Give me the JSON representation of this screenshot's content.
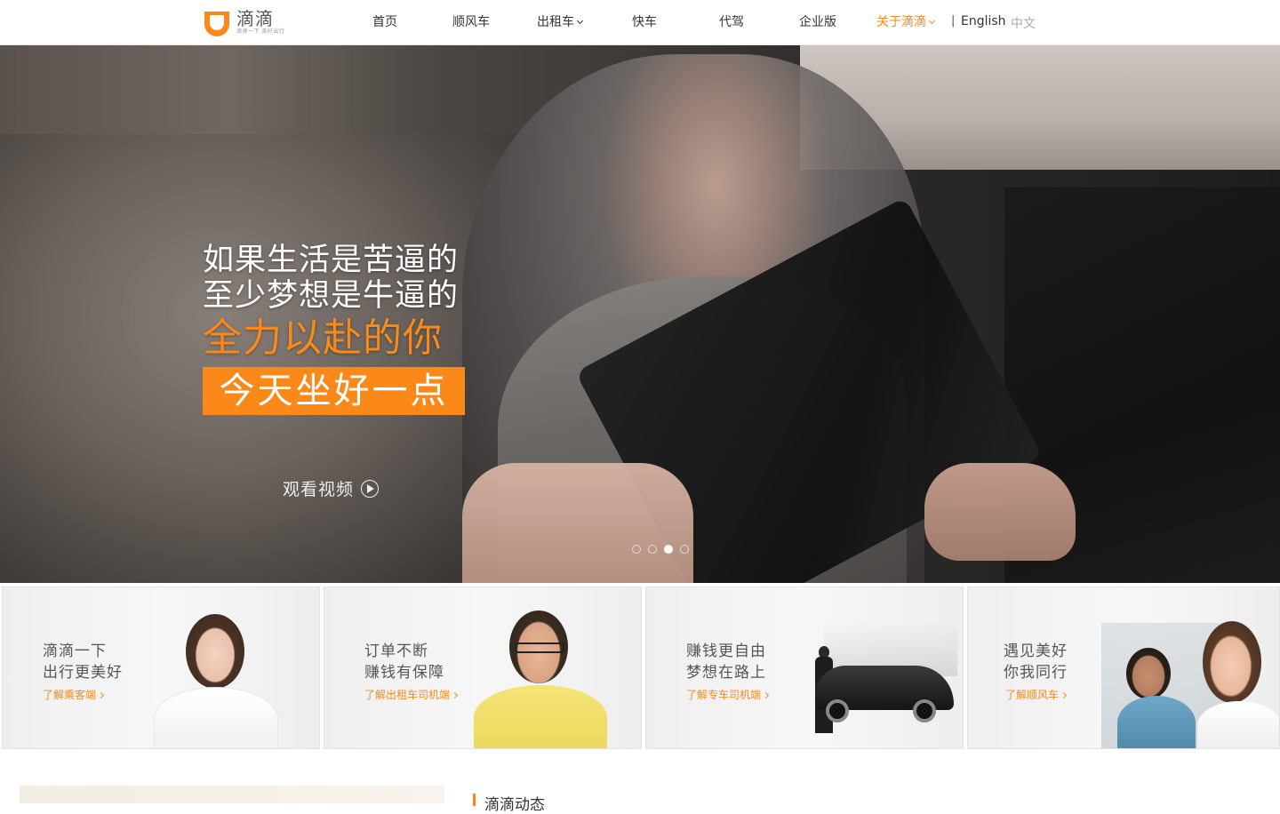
{
  "header": {
    "logo": {
      "name": "滴滴",
      "slogan": "滴滴一下 美好出行",
      "icon": "didi-logo-icon",
      "color": "#fa8919"
    },
    "nav": [
      {
        "label": "首页"
      },
      {
        "label": "顺风车"
      },
      {
        "label": "出租车",
        "dropdown": true
      },
      {
        "label": "快车"
      },
      {
        "label": "代驾"
      },
      {
        "label": "企业版"
      },
      {
        "label": "关于滴滴",
        "dropdown": true,
        "active": true
      }
    ],
    "lang_separator": "|",
    "lang_en": "English",
    "lang_zh": "中文"
  },
  "hero": {
    "line1": "如果生活是苦逼的",
    "line2": "至少梦想是牛逼的",
    "line3": "全力以赴的你",
    "highlight": "今天坐好一点",
    "video_label": "观看视频",
    "video_icon": "play-circle-icon",
    "slides": 4,
    "active_slide": 3
  },
  "cards": [
    {
      "title_line1": "滴滴一下",
      "title_line2": "出行更美好",
      "link": "了解乘客端"
    },
    {
      "title_line1": "订单不断",
      "title_line2": "赚钱有保障",
      "link": "了解出租车司机端"
    },
    {
      "title_line1": "赚钱更自由",
      "title_line2": "梦想在路上",
      "link": "了解专车司机端"
    },
    {
      "title_line1": "遇见美好",
      "title_line2": "你我同行",
      "link": "了解顺风车"
    }
  ],
  "news": {
    "title": "滴滴动态"
  },
  "colors": {
    "accent": "#fa8919",
    "text": "#333333",
    "muted": "#aaaaaa"
  }
}
